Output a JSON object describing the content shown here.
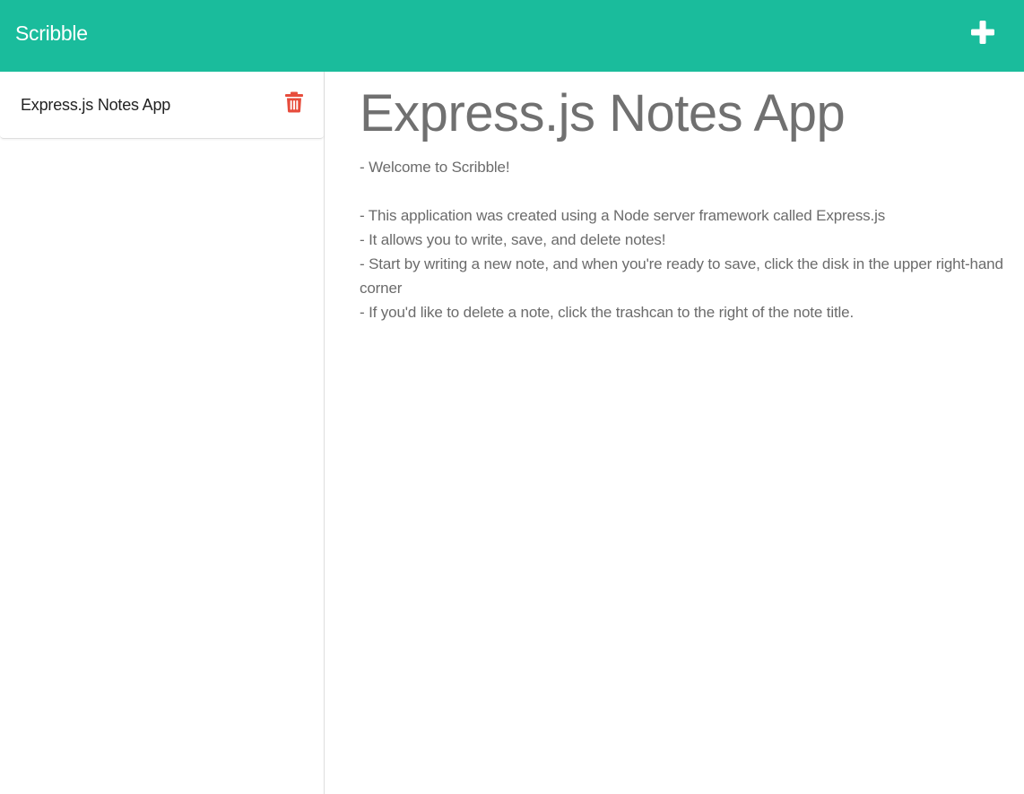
{
  "header": {
    "brand": "Scribble",
    "new_note_icon": "plus-icon",
    "background_color": "#1abc9c"
  },
  "sidebar": {
    "notes": [
      {
        "title": "Express.js Notes App",
        "delete_icon": "trash-icon",
        "delete_icon_color": "#e74c3c"
      }
    ]
  },
  "active_note": {
    "title": "Express.js Notes App",
    "body_lines": [
      "- Welcome to Scribble!",
      "",
      "- This application was created using a Node server framework called Express.js",
      "- It allows you to write, save, and delete notes!",
      "- Start by writing a new note, and when you're ready to save, click the disk in the upper right-hand corner",
      "- If you'd like to delete a note, click the trashcan to the right of the note title."
    ]
  }
}
